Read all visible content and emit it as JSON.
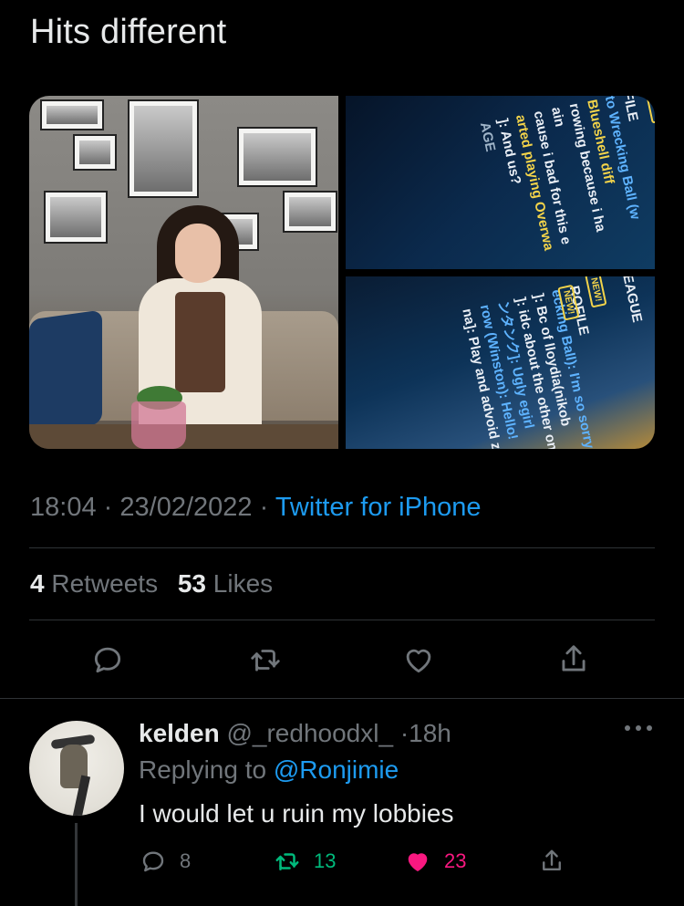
{
  "tweet": {
    "text": "Hits different",
    "time": "18:04",
    "date": "23/02/2022",
    "separator": "·",
    "source": "Twitter for iPhone",
    "retweets_count": "4",
    "retweets_label": "Retweets",
    "likes_count": "53",
    "likes_label": "Likes"
  },
  "media": {
    "screen_top_lines": [
      "FILE",
      "to Wrecking Ball (w",
      "Blueshell diff",
      "rowing because i ha",
      "ain",
      "cause i bad for this e",
      "arted playing Overwa",
      "]: And us?",
      "AGE"
    ],
    "screen_top_badge": "NEW!",
    "screen_bottom_lines": [
      "EAGUE",
      "ROFILE",
      "ecking Ball): I'm so sorry.",
      "]: Bc of lloydia(nikob",
      "]: idc about the other ones",
      "ンタンク]: Ugly egirl",
      "row (Winston): Hello!",
      "na]: Play and advoid z"
    ],
    "screen_bottom_badges": [
      "NEW!",
      "NEW!"
    ]
  },
  "actions": {
    "reply_icon": "reply-icon",
    "retweet_icon": "retweet-icon",
    "like_icon": "heart-icon",
    "share_icon": "share-icon"
  },
  "reply": {
    "name": "kelden",
    "handle": "@_redhoodxl_",
    "separator": "·",
    "time": "18h",
    "replying_to_label": "Replying to",
    "replying_to_handle": "@Ronjimie",
    "text": "I would let u ruin my lobbies",
    "reply_count": "8",
    "retweet_count": "13",
    "like_count": "23",
    "colors": {
      "retweet": "#00ba7c",
      "like": "#f91880",
      "link": "#1d9bf0"
    }
  }
}
